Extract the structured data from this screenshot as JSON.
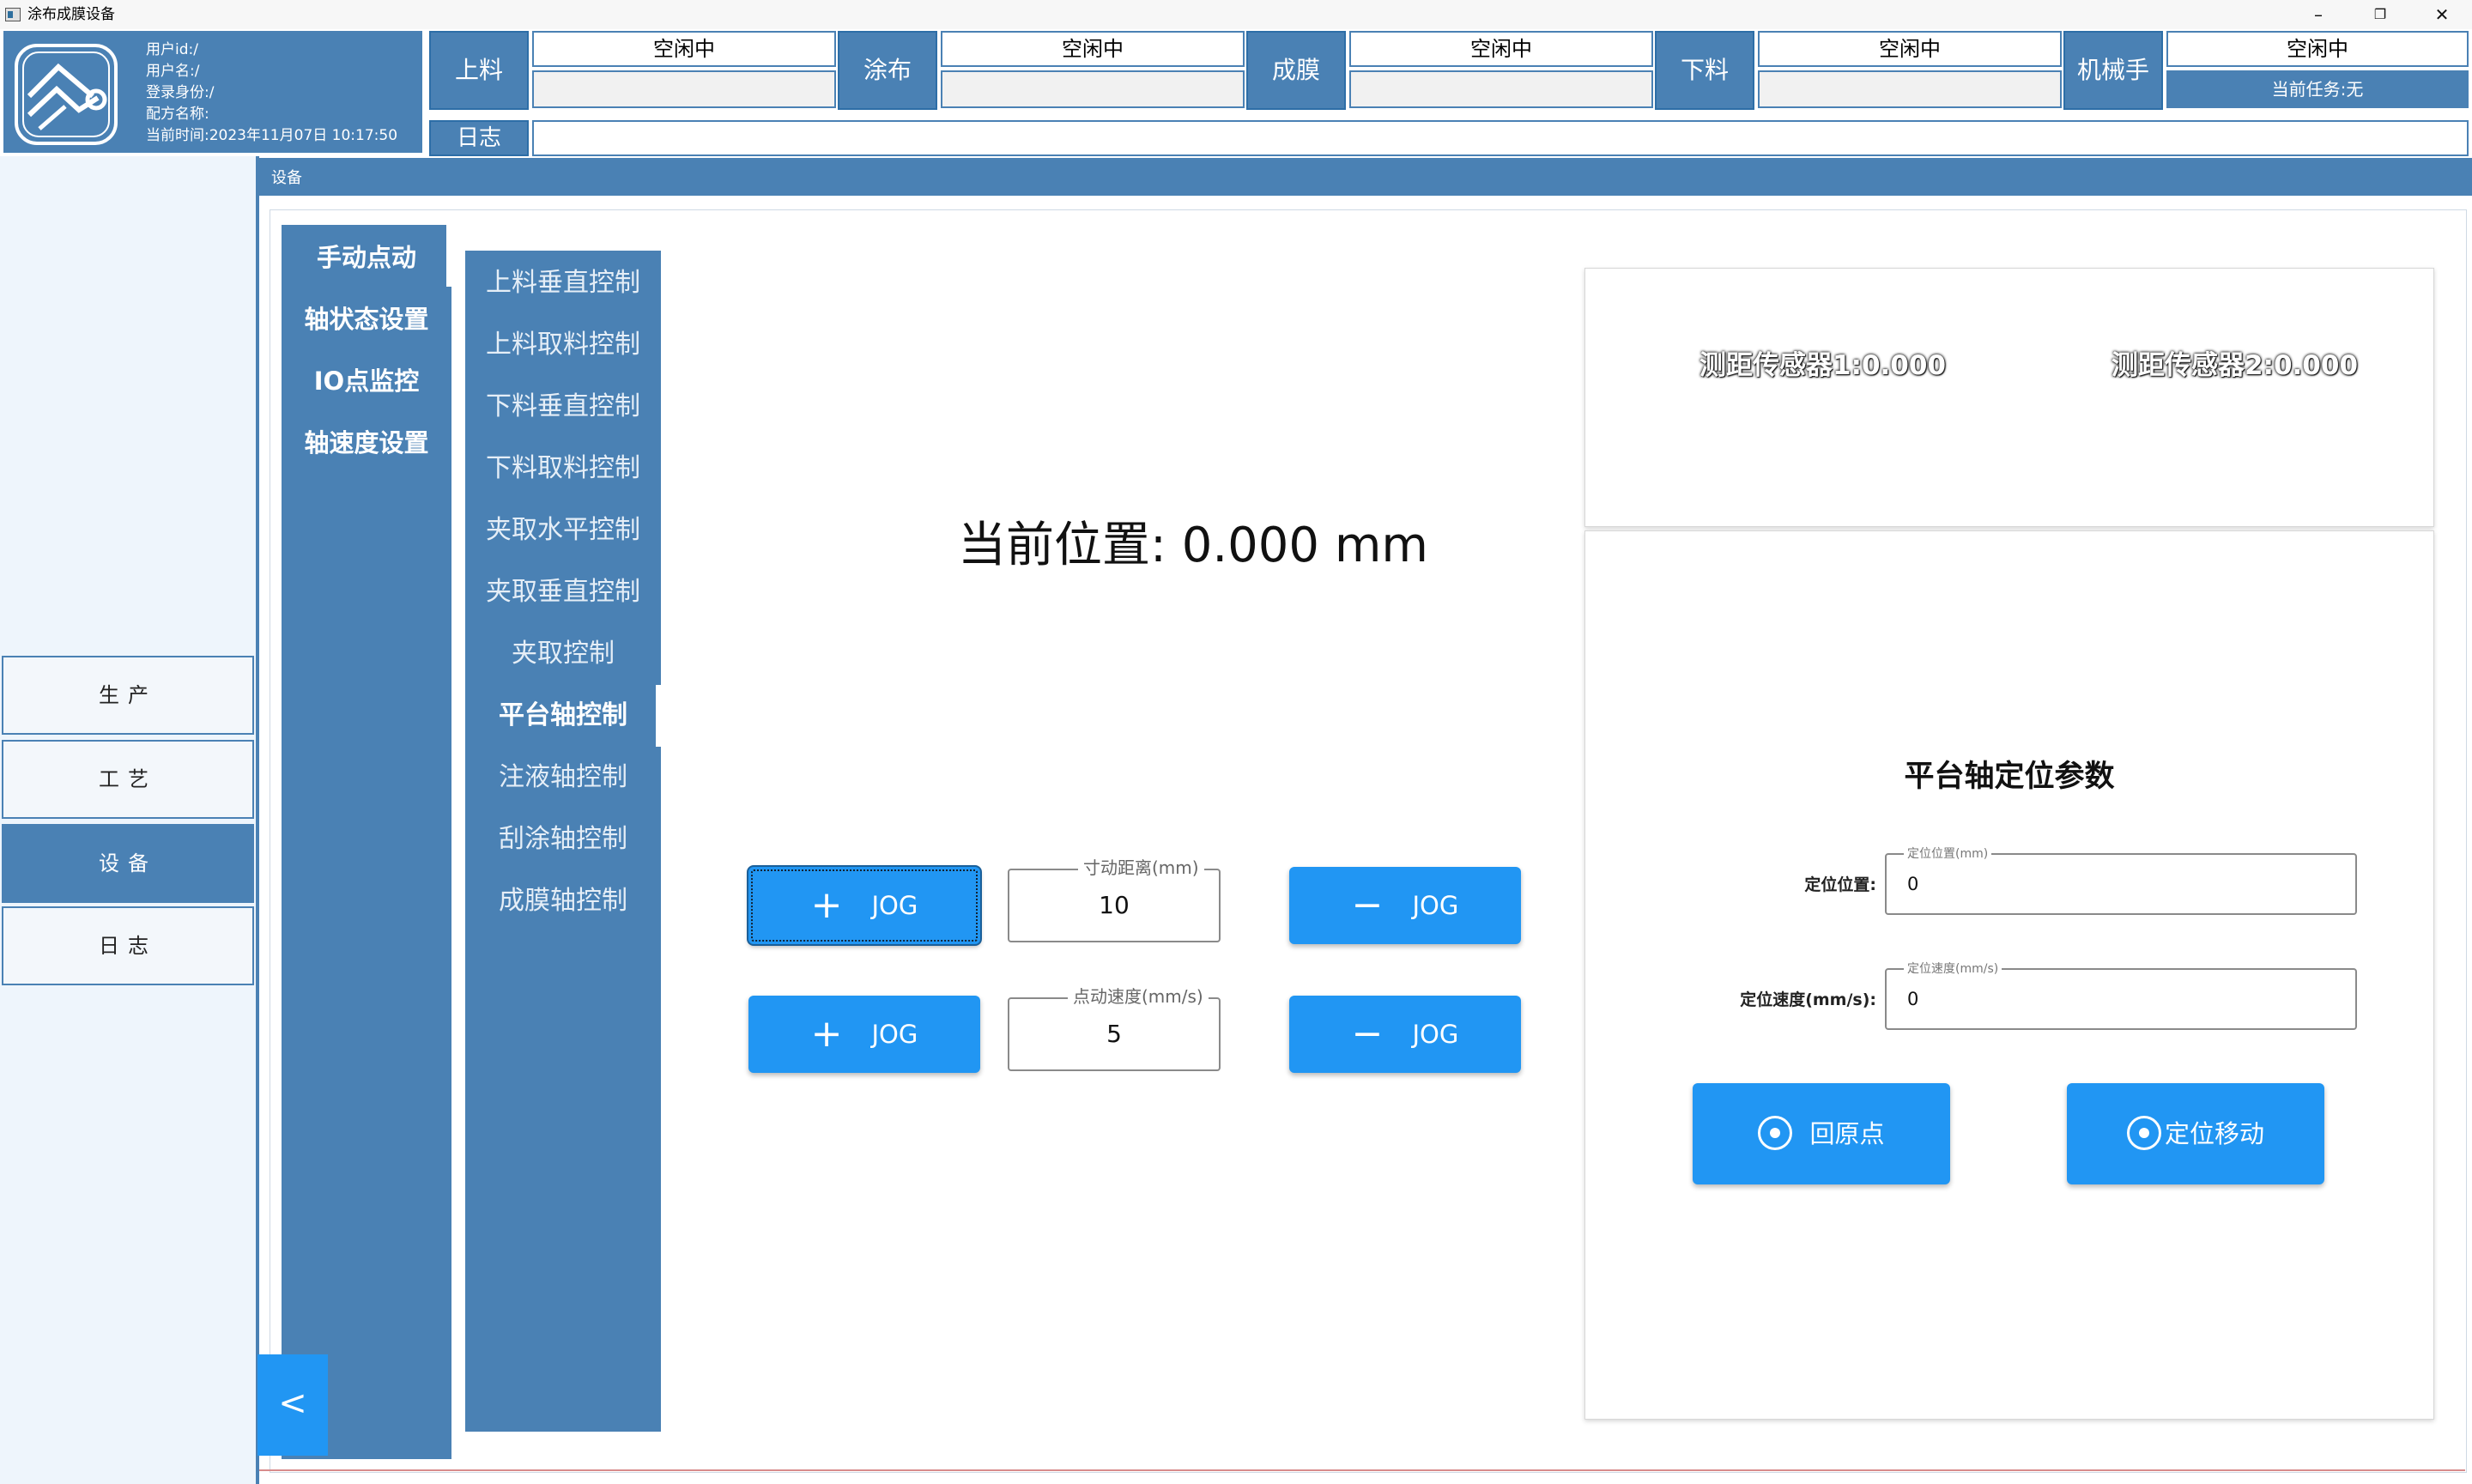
{
  "window": {
    "title": "涂布成膜设备",
    "controls": {
      "minimize": "–",
      "restore": "❐",
      "close": "✕"
    }
  },
  "header": {
    "user_info": [
      "用户id:/",
      "用户名:/",
      "登录身份:/",
      "配方名称:",
      "当前时间:2023年11月07日 10:17:50"
    ],
    "stations": [
      {
        "label": "上料",
        "status": "空闲中"
      },
      {
        "label": "涂布",
        "status": "空闲中"
      },
      {
        "label": "成膜",
        "status": "空闲中"
      },
      {
        "label": "下料",
        "status": "空闲中"
      },
      {
        "label": "机械手",
        "status": "空闲中",
        "task": "当前任务:无"
      }
    ],
    "log_label": "日志"
  },
  "left_nav": {
    "items": [
      {
        "label": "生产",
        "active": false
      },
      {
        "label": "工艺",
        "active": false
      },
      {
        "label": "设备",
        "active": true
      },
      {
        "label": "日志",
        "active": false
      }
    ]
  },
  "content": {
    "section_title": "设备",
    "categories": [
      "手动点动",
      "轴状态设置",
      "IO点监控",
      "轴速度设置"
    ],
    "active_category": "手动点动",
    "subitems": [
      "上料垂直控制",
      "上料取料控制",
      "下料垂直控制",
      "下料取料控制",
      "夹取水平控制",
      "夹取垂直控制",
      "夹取控制",
      "平台轴控制",
      "注液轴控制",
      "刮涂轴控制",
      "成膜轴控制"
    ],
    "active_subitem": "平台轴控制",
    "collapse_label": "<"
  },
  "jog": {
    "current_position": "当前位置: 0.000 mm",
    "plus_label": "JOG",
    "minus_label": "JOG",
    "distance_legend": "寸动距离(mm)",
    "distance_value": "10",
    "speed_legend": "点动速度(mm/s)",
    "speed_value": "5"
  },
  "sensors": {
    "sensor1": "测距传感器1:0.000",
    "sensor2": "测距传感器2:0.000"
  },
  "positioning": {
    "title": "平台轴定位参数",
    "position_label": "定位位置:",
    "position_legend": "定位位置(mm)",
    "position_value": "0",
    "speed_label": "定位速度(mm/s):",
    "speed_legend": "定位速度(mm/s)",
    "speed_value": "0",
    "home_button": "回原点",
    "move_button": "定位移动"
  },
  "colors": {
    "primary": "#4a81b4",
    "accent": "#2196f3"
  }
}
